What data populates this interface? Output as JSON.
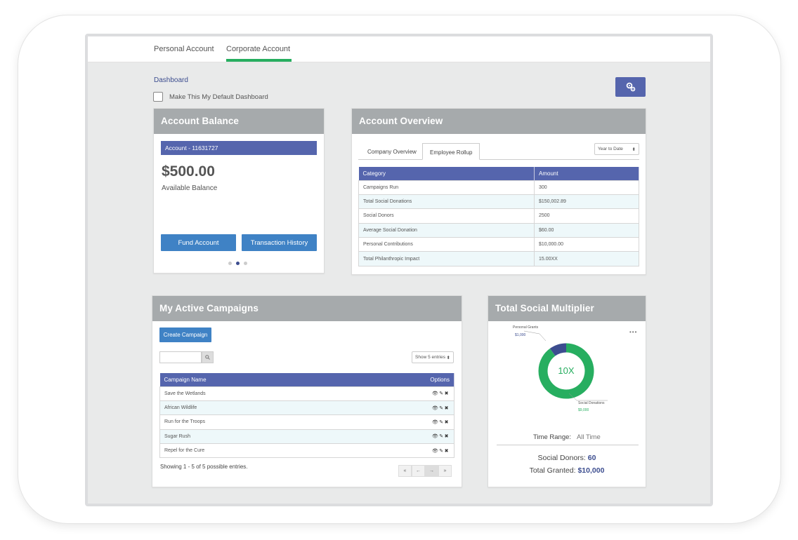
{
  "tabs": {
    "personal": "Personal Account",
    "corporate": "Corporate Account"
  },
  "breadcrumb": "Dashboard",
  "default_checkbox": {
    "label": "Make This My Default Dashboard",
    "checked": false
  },
  "gear_icon": "gears-icon",
  "colors": {
    "primary": "#5565ad",
    "accent_green": "#27ae60",
    "button_blue": "#3f82c5",
    "card_header": "#a6aaac",
    "donut_blue": "#3c4d8f"
  },
  "account_balance": {
    "title": "Account Balance",
    "account_label": "Account - 11631727",
    "amount": "$500.00",
    "amount_label": "Available Balance",
    "fund_button": "Fund Account",
    "history_button": "Transaction History",
    "carousel_active_index": 1
  },
  "account_overview": {
    "title": "Account Overview",
    "tabs": [
      "Company Overview",
      "Employee Rollup"
    ],
    "active_tab": "Employee Rollup",
    "range_select": "Year to Date",
    "columns": [
      "Category",
      "Amount"
    ],
    "rows": [
      [
        "Campaigns Run",
        "300"
      ],
      [
        "Total Social Donations",
        "$150,002.89"
      ],
      [
        "Social Donors",
        "2500"
      ],
      [
        "Average Social Donation",
        "$60.00"
      ],
      [
        "Personal Contributions",
        "$10,000.00"
      ],
      [
        "Total Philanthropic Impact",
        "15.00XX"
      ]
    ]
  },
  "campaigns": {
    "title": "My Active Campaigns",
    "create_button": "Create Campaign",
    "show_select": "Show 5 entries",
    "search_placeholder": "",
    "columns": [
      "Campaign Name",
      "Options"
    ],
    "rows": [
      "Save the Wetlands",
      "African Wildlife",
      "Run for the Troops",
      "Sugar Rush",
      "Repel for the Cure"
    ],
    "option_icons": [
      "eye-icon",
      "pencil-icon",
      "close-icon"
    ],
    "footer": "Showing 1 - 5 of 5 possible entries.",
    "pager": [
      "«",
      "←",
      "→",
      "»"
    ]
  },
  "multiplier": {
    "title": "Total Social Multiplier",
    "menu_icon": "more-icon",
    "center_label": "10X",
    "personal_label": "Personal Grants",
    "personal_value": "$1,000",
    "social_label": "Social Donations",
    "social_value": "$9,000",
    "time_range_label": "Time Range:",
    "time_range_value": "All Time",
    "donors_label": "Social Donors:",
    "donors_value": "60",
    "granted_label": "Total Granted:",
    "granted_value": "$10,000"
  },
  "chart_data": {
    "type": "pie",
    "categories": [
      "Personal Grants",
      "Social Donations"
    ],
    "values": [
      1000,
      9000
    ],
    "title": "Total Social Multiplier"
  }
}
